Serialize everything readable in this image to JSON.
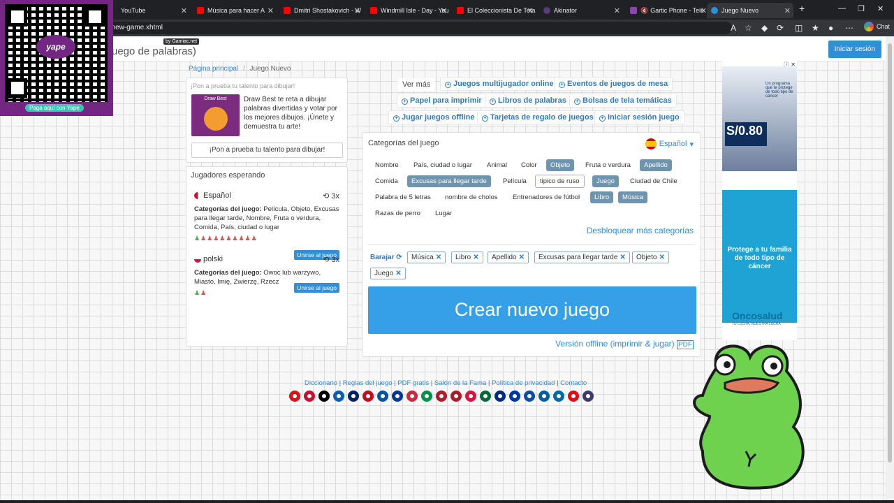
{
  "browser": {
    "tabs": [
      {
        "title": "YouTube",
        "color": "#ff0000"
      },
      {
        "title": "Música para hacer A",
        "color": "#ff0000"
      },
      {
        "title": "Dmitri Shostakovich - W",
        "color": "#ff0000"
      },
      {
        "title": "Windmill Isle - Day - You",
        "color": "#ff0000"
      },
      {
        "title": "El Coleccionista De Teta",
        "color": "#ff0000"
      },
      {
        "title": "Akinator",
        "color": "#5b3b7a"
      },
      {
        "title": "Gartic Phone - Telé",
        "color": "#8e44ad"
      },
      {
        "title": "Juego Nuevo",
        "color": "#2f8fd8"
      }
    ],
    "url": "t/new-game.xhtml",
    "chat_label": "Chat"
  },
  "overlay_qr": {
    "brand": "yape",
    "pay_label": "Paga aquí con Yape"
  },
  "site": {
    "title": "uego de palabras)",
    "badge": "by Gamiac.net",
    "login": "Iniciar sesión"
  },
  "breadcrumb": {
    "home": "Página principal",
    "sep": "/",
    "current": "Juego Nuevo"
  },
  "promo": {
    "heading": "¡Pon a prueba tu talento para dibujar!",
    "image_label": "Draw Best",
    "text": "Draw Best te reta a dibujar palabras divertidas y votar por los mejores dibujos. ¡Únete y demuestra tu arte!",
    "button": "¡Pon a prueba tu talento para dibujar!"
  },
  "players": {
    "heading": "Jugadores esperando",
    "entries": [
      {
        "lang": "Español",
        "count": "3x",
        "cat_label": "Categorías del juego:",
        "cats": "Película, Objeto, Excusas para llegar tarde, Nombre, Fruta o verdura, Comida, País, ciudad o lugar",
        "dots": "♟♟♟♟♟♟♟♟♟♟",
        "join": "Unirse al juego"
      },
      {
        "lang": "polski",
        "count": "3x",
        "cat_label": "Categorías del juego:",
        "cats": "Owoc lub warzywo, Miasto, Imię, Zwierzę, Rzecz",
        "dots": "♟♟",
        "join": "Unirse al juego"
      }
    ]
  },
  "top_links": {
    "ver_mas": "Ver más",
    "items": [
      "Juegos multijugador online",
      "Eventos de juegos de mesa",
      "Papel para imprimir",
      "Libros de palabras",
      "Bolsas de tela temáticas",
      "Jugar juegos offline",
      "Tarjetas de regalo de juegos",
      "Iniciar sesión juego"
    ]
  },
  "main": {
    "heading": "Categorías del juego",
    "language": "Español",
    "categories": [
      {
        "label": "Nombre",
        "state": "none"
      },
      {
        "label": "País, ciudad o lugar",
        "state": "none"
      },
      {
        "label": "Animal",
        "state": "none"
      },
      {
        "label": "Color",
        "state": "none"
      },
      {
        "label": "Objeto",
        "state": "selected"
      },
      {
        "label": "Fruta o verdura",
        "state": "none"
      },
      {
        "label": "Apellido",
        "state": "selected"
      },
      {
        "label": "Comida",
        "state": "none"
      },
      {
        "label": "Excusas para llegar tarde",
        "state": "selected"
      },
      {
        "label": "Película",
        "state": "none"
      },
      {
        "label": "tipico de ruso",
        "state": "hover"
      },
      {
        "label": "Juego",
        "state": "selected"
      },
      {
        "label": "Ciudad de Chile",
        "state": "none"
      },
      {
        "label": "Palabra de 5 letras",
        "state": "none"
      },
      {
        "label": "nombre de cholos",
        "state": "none"
      },
      {
        "label": "Entrenadores de fútbol",
        "state": "none"
      },
      {
        "label": "Libro",
        "state": "selected"
      },
      {
        "label": "Música",
        "state": "selected"
      },
      {
        "label": "Razas de perro",
        "state": "none"
      },
      {
        "label": "Lugar",
        "state": "none"
      }
    ],
    "unlock": "Desbloquear más categorías",
    "shuffle": "Barajar",
    "selected_tags": [
      "Música",
      "Libro",
      "Apellido",
      "Excusas para llegar tarde",
      "Objeto",
      "Juego"
    ],
    "create": "Crear nuevo juego",
    "offline": "Versión offline (imprimir & jugar)"
  },
  "footer": {
    "links": [
      "Diccionario",
      "Reglas del juego",
      "PDF gratis",
      "Salón de la Fama",
      "Política de privacidad",
      "Contacto"
    ],
    "flags": [
      "#d7141a",
      "#c8102e",
      "#000000",
      "#0d5eaf",
      "#012169",
      "#c60b1e",
      "#0055a4",
      "#003893",
      "#cd2a3e",
      "#009246",
      "#ae1c28",
      "#ae1c28",
      "#dc143c",
      "#046a38",
      "#002b7f",
      "#0039a6",
      "#0b4ea2",
      "#005da4",
      "#006aa7",
      "#e30a17",
      "#3c3b6e"
    ]
  },
  "ad": {
    "top_text": "Un programa que te protege de todo tipo de cáncer",
    "product": "S/0.80",
    "headline": "Protege a tu familia de todo tipo de cáncer",
    "brand": "Oncosalud",
    "tagline": "TU LUCHA, NUESTRA LUCHA"
  }
}
